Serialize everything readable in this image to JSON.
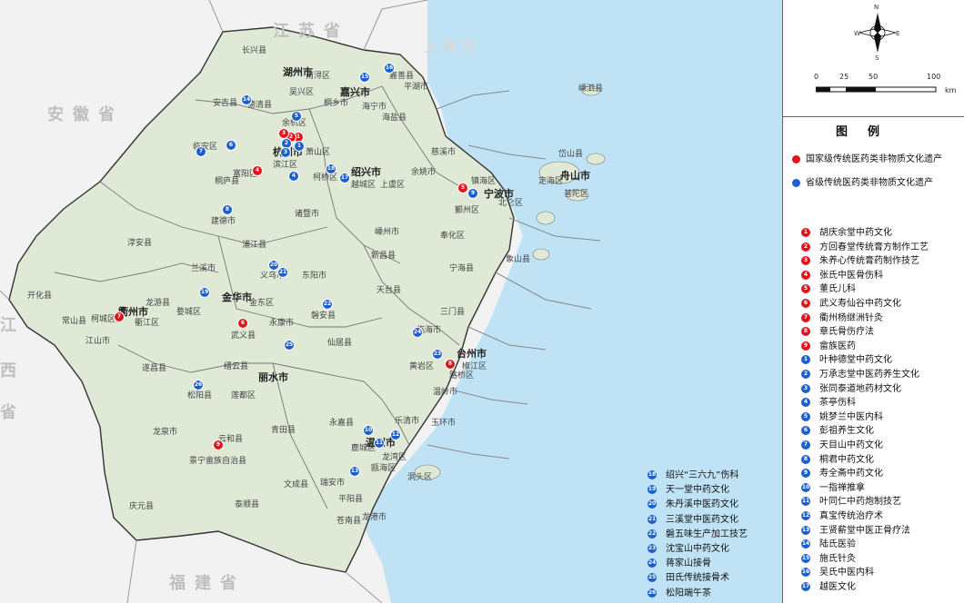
{
  "map": {
    "provinces": {
      "jiangsu": "江苏省",
      "anhui": "安徽省",
      "jiangxi_1": "江",
      "jiangxi_2": "西",
      "jiangxi_3": "省",
      "fujian": "福建省",
      "shanghai": "上海市"
    },
    "cities": {
      "huzhou": "湖州市",
      "jiaxing": "嘉兴市",
      "shaoxing": "绍兴市",
      "ningbo": "宁波市",
      "zhoushan": "舟山市",
      "jinhua": "金华市",
      "quzhou": "衢州市",
      "lishui": "丽水市",
      "taizhou": "台州市",
      "wenzhou": "温州市",
      "hangzhou": "杭州市"
    },
    "counties": [
      "长兴县",
      "安吉县",
      "德清县",
      "南浔区",
      "吴兴区",
      "嘉善县",
      "平湖市",
      "海盐县",
      "海宁市",
      "桐乡市",
      "余杭区",
      "临安区",
      "富阳区",
      "萧山区",
      "滨江区",
      "柯桥区",
      "越城区",
      "上虞区",
      "慈溪市",
      "余姚市",
      "镇海区",
      "北仑区",
      "鄞州区",
      "奉化区",
      "象山县",
      "宁海县",
      "定海区",
      "普陀区",
      "岱山县",
      "嵊泗县",
      "诸暨市",
      "嵊州市",
      "新昌县",
      "桐庐县",
      "建德市",
      "淳安县",
      "浦江县",
      "兰溪市",
      "义乌市",
      "东阳市",
      "磐安县",
      "永康市",
      "武义县",
      "金东区",
      "婺城区",
      "天台县",
      "三门县",
      "临海市",
      "仙居县",
      "黄岩区",
      "椒江区",
      "路桥区",
      "温岭市",
      "玉环市",
      "开化县",
      "常山县",
      "江山市",
      "柯城区",
      "衢江区",
      "龙游县",
      "遂昌县",
      "松阳县",
      "缙云县",
      "莲都区",
      "青田县",
      "云和县",
      "景宁畲族自治县",
      "龙泉市",
      "庆元县",
      "永嘉县",
      "瓯海区",
      "鹿城区",
      "龙湾区",
      "洞头区",
      "瑞安市",
      "文成县",
      "泰顺县",
      "平阳县",
      "苍南县",
      "龙港市",
      "乐清市"
    ],
    "sea_labels": [
      "嵊泗县",
      "嵊泗县"
    ],
    "markers": [
      {
        "n": "1",
        "t": "red"
      },
      {
        "n": "2",
        "t": "red"
      },
      {
        "n": "3",
        "t": "red"
      },
      {
        "n": "4",
        "t": "red"
      },
      {
        "n": "5",
        "t": "red"
      },
      {
        "n": "6",
        "t": "red"
      },
      {
        "n": "7",
        "t": "red"
      },
      {
        "n": "8",
        "t": "red"
      },
      {
        "n": "9",
        "t": "red"
      },
      {
        "n": "1",
        "t": "blue"
      },
      {
        "n": "2",
        "t": "blue"
      },
      {
        "n": "3",
        "t": "blue"
      },
      {
        "n": "4",
        "t": "blue"
      },
      {
        "n": "5",
        "t": "blue"
      },
      {
        "n": "6",
        "t": "blue"
      },
      {
        "n": "7",
        "t": "blue"
      },
      {
        "n": "8",
        "t": "blue"
      },
      {
        "n": "9",
        "t": "blue"
      },
      {
        "n": "10",
        "t": "blue"
      },
      {
        "n": "11",
        "t": "blue"
      },
      {
        "n": "12",
        "t": "blue"
      },
      {
        "n": "13",
        "t": "blue"
      },
      {
        "n": "14",
        "t": "blue"
      },
      {
        "n": "15",
        "t": "blue"
      },
      {
        "n": "16",
        "t": "blue"
      },
      {
        "n": "17",
        "t": "blue"
      },
      {
        "n": "18",
        "t": "blue"
      },
      {
        "n": "19",
        "t": "blue"
      },
      {
        "n": "20",
        "t": "blue"
      },
      {
        "n": "21",
        "t": "blue"
      },
      {
        "n": "22",
        "t": "blue"
      },
      {
        "n": "23",
        "t": "blue"
      },
      {
        "n": "24",
        "t": "blue"
      },
      {
        "n": "25",
        "t": "blue"
      },
      {
        "n": "26",
        "t": "blue"
      }
    ]
  },
  "compass": {
    "n": "N",
    "s": "S",
    "e": "E",
    "w": "W"
  },
  "scale": {
    "ticks": [
      "0",
      "25",
      "50",
      "100"
    ],
    "unit": "km"
  },
  "legend": {
    "title": "图例",
    "national": "国家级传统医药类非物质文化遗产",
    "provincial": "省级传统医药类非物质文化遗产",
    "colors": {
      "national": "#e0141c",
      "provincial": "#1e5fcf"
    },
    "national_items": [
      {
        "n": "1",
        "name": "胡庆余堂中药文化"
      },
      {
        "n": "2",
        "name": "方回春堂传统膏方制作工艺"
      },
      {
        "n": "3",
        "name": "朱养心传统膏药制作技艺"
      },
      {
        "n": "4",
        "name": "张氏中医骨伤科"
      },
      {
        "n": "5",
        "name": "董氏儿科"
      },
      {
        "n": "6",
        "name": "武义寿仙谷中药文化"
      },
      {
        "n": "7",
        "name": "衢州杨继洲针灸"
      },
      {
        "n": "8",
        "name": "章氏骨伤疗法"
      },
      {
        "n": "9",
        "name": "畲族医药"
      }
    ],
    "provincial_items": [
      {
        "n": "1",
        "name": "叶种德堂中药文化"
      },
      {
        "n": "2",
        "name": "万承志堂中医药养生文化"
      },
      {
        "n": "3",
        "name": "张同泰道地药材文化"
      },
      {
        "n": "4",
        "name": "茶亭伤科"
      },
      {
        "n": "5",
        "name": "姚梦兰中医内科"
      },
      {
        "n": "6",
        "name": "彭祖养生文化"
      },
      {
        "n": "7",
        "name": "天目山中药文化"
      },
      {
        "n": "8",
        "name": "桐君中药文化"
      },
      {
        "n": "9",
        "name": "寿全斋中药文化"
      },
      {
        "n": "10",
        "name": "一指禅推拿"
      },
      {
        "n": "11",
        "name": "叶同仁中药炮制技艺"
      },
      {
        "n": "12",
        "name": "真宝传统治疗术"
      },
      {
        "n": "13",
        "name": "王贤薪堂中医正骨疗法"
      },
      {
        "n": "14",
        "name": "陆氏医验"
      },
      {
        "n": "15",
        "name": "施氏针灸"
      },
      {
        "n": "16",
        "name": "吴氏中医内科"
      },
      {
        "n": "17",
        "name": "越医文化"
      }
    ],
    "provincial_items_2": [
      {
        "n": "18",
        "name": "绍兴“三六九”伤科"
      },
      {
        "n": "19",
        "name": "天一堂中药文化"
      },
      {
        "n": "20",
        "name": "朱丹溪中医药文化"
      },
      {
        "n": "21",
        "name": "三溪堂中医药文化"
      },
      {
        "n": "22",
        "name": "磐五味生产加工技艺"
      },
      {
        "n": "23",
        "name": "沈宝山中药文化"
      },
      {
        "n": "24",
        "name": "蒋家山接骨"
      },
      {
        "n": "25",
        "name": "田氏传统接骨术"
      },
      {
        "n": "26",
        "name": "松阳端午茶"
      }
    ]
  }
}
